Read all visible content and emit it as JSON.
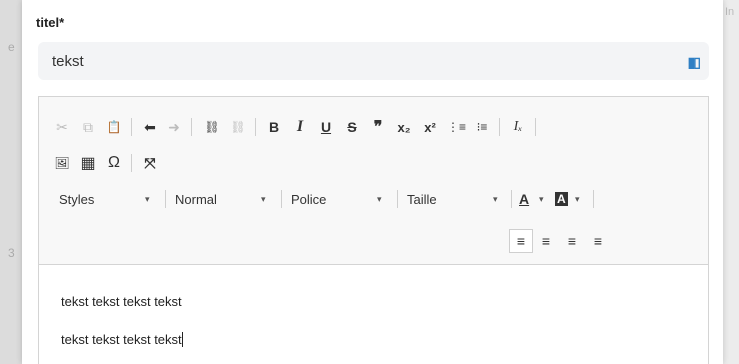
{
  "background": {
    "left_fragment_1": "e",
    "left_fragment_2": "3",
    "right_fragment": "In"
  },
  "field": {
    "label": "titel*",
    "value": "tekst",
    "icon": "extension-icon"
  },
  "toolbar": {
    "row1": [
      {
        "name": "cut-icon",
        "glyph": "✂",
        "disabled": true
      },
      {
        "name": "copy-icon",
        "glyph": "⧉",
        "disabled": true
      },
      {
        "name": "paste-icon",
        "glyph": "📋",
        "disabled": false
      },
      {
        "name": "undo-icon",
        "glyph": "⬅",
        "disabled": false
      },
      {
        "name": "redo-icon",
        "glyph": "➜",
        "disabled": true
      },
      {
        "name": "link-icon",
        "glyph": "⛓",
        "disabled": false
      },
      {
        "name": "unlink-icon",
        "glyph": "⛓",
        "disabled": true
      },
      {
        "name": "bold-icon",
        "glyph": "B",
        "disabled": false
      },
      {
        "name": "italic-icon",
        "glyph": "I",
        "disabled": false
      },
      {
        "name": "underline-icon",
        "glyph": "U",
        "disabled": false
      },
      {
        "name": "strikethrough-icon",
        "glyph": "S",
        "disabled": false
      },
      {
        "name": "blockquote-icon",
        "glyph": "❞",
        "disabled": false
      },
      {
        "name": "subscript-icon",
        "glyph": "x₂",
        "disabled": false
      },
      {
        "name": "superscript-icon",
        "glyph": "x²",
        "disabled": false
      },
      {
        "name": "numbered-list-icon",
        "glyph": "⋮≡",
        "disabled": false
      },
      {
        "name": "bulleted-list-icon",
        "glyph": "⁝≡",
        "disabled": false
      },
      {
        "name": "remove-format-icon",
        "glyph": "Iₓ",
        "disabled": false
      }
    ],
    "row2": [
      {
        "name": "image-icon",
        "glyph": "🖼"
      },
      {
        "name": "table-icon",
        "glyph": "▦"
      },
      {
        "name": "special-char-icon",
        "glyph": "Ω"
      },
      {
        "name": "maximize-icon",
        "glyph": "⤧"
      }
    ],
    "combos": {
      "styles": "Styles",
      "format": "Normal",
      "font": "Police",
      "size": "Taille"
    },
    "text_color_glyph": "A",
    "bg_color_glyph": "A",
    "dropdown_arrow": "▾",
    "align": [
      {
        "name": "align-left-icon",
        "glyph": "≡"
      },
      {
        "name": "align-center-icon",
        "glyph": "≡"
      },
      {
        "name": "align-right-icon",
        "glyph": "≡"
      },
      {
        "name": "align-justify-icon",
        "glyph": "≡"
      }
    ]
  },
  "content": {
    "paragraphs": [
      "tekst tekst tekst tekst",
      "tekst tekst tekst tekst"
    ]
  }
}
